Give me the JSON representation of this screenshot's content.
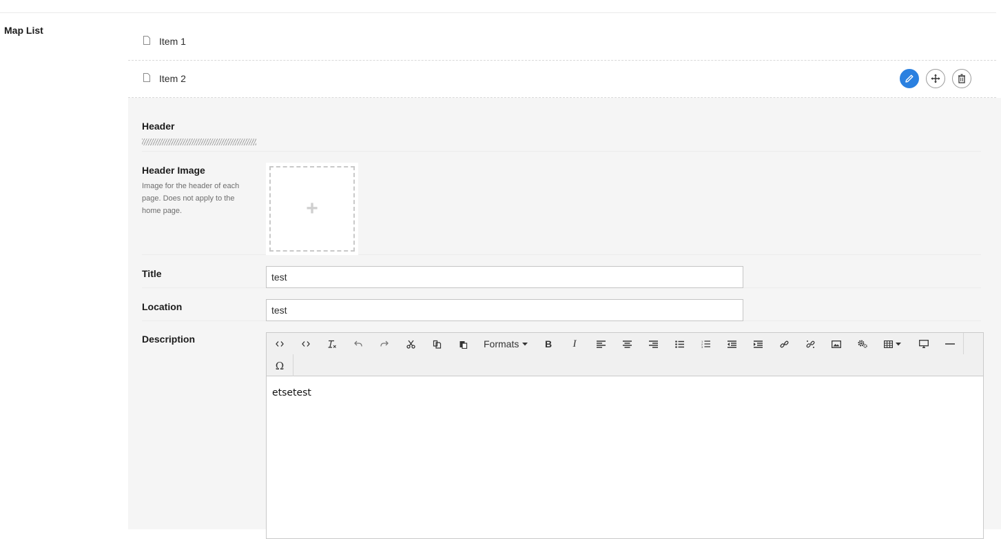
{
  "section": {
    "label": "Map List"
  },
  "items": [
    {
      "label": "Item 1"
    },
    {
      "label": "Item 2"
    }
  ],
  "item_actions": {
    "edit_icon": "pencil-icon",
    "move_icon": "move-icon",
    "delete_icon": "trash-icon",
    "accent": "#2a80e0"
  },
  "form": {
    "header": {
      "label": "Header"
    },
    "header_image": {
      "label": "Header Image",
      "help": "Image for the header of each page. Does not apply to the home page.",
      "add_symbol": "+"
    },
    "title": {
      "label": "Title",
      "value": "test"
    },
    "location": {
      "label": "Location",
      "value": "test"
    },
    "description": {
      "label": "Description",
      "content": "etsetest"
    }
  },
  "toolbar": {
    "formats_label": "Formats",
    "buttons": [
      "source-code",
      "code",
      "clear-formatting",
      "undo",
      "redo",
      "cut",
      "copy",
      "paste",
      "formats",
      "bold",
      "italic",
      "align-left",
      "align-center",
      "align-right",
      "bullet-list",
      "numbered-list",
      "outdent",
      "indent",
      "link",
      "unlink",
      "image",
      "plugin",
      "table",
      "preview",
      "horizontal-rule",
      "special-character"
    ],
    "bold_glyph": "B",
    "italic_glyph": "I",
    "omega_glyph": "Ω"
  }
}
